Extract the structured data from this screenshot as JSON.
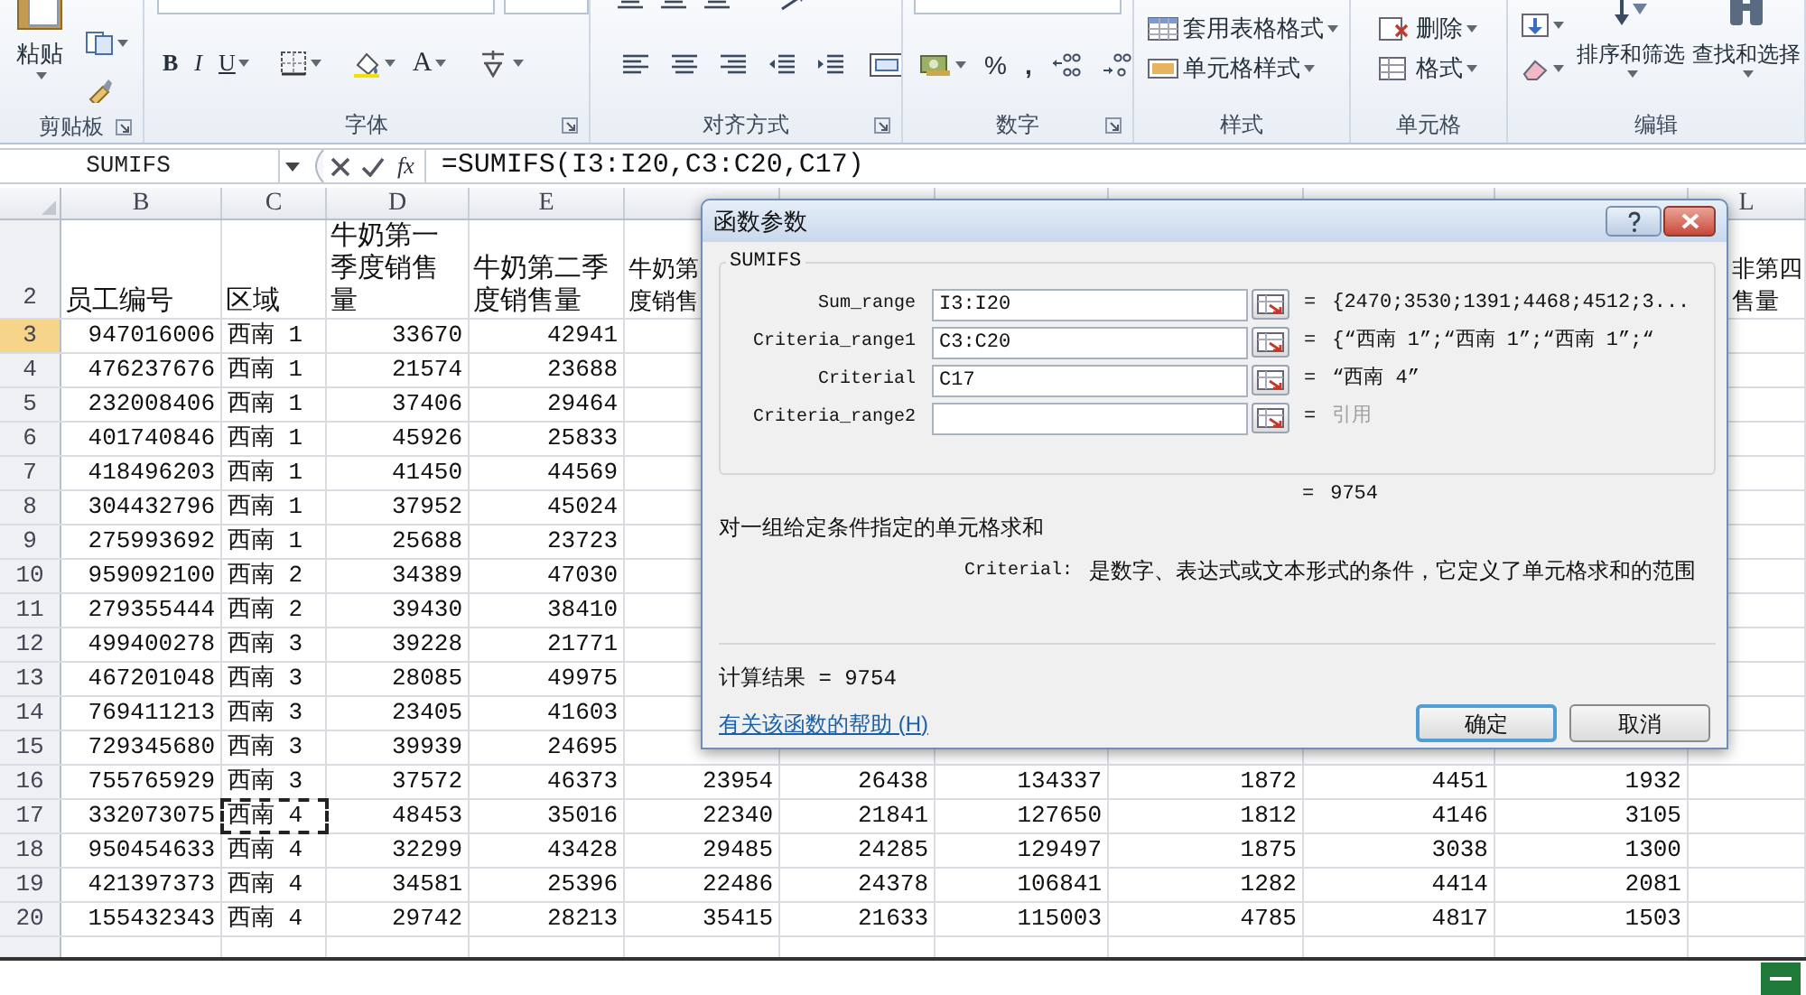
{
  "ribbon": {
    "paste": "粘贴",
    "bold": "B",
    "italic": "I",
    "underline": "U",
    "font_color": "A",
    "percent": "%",
    "comma": ",",
    "table_format": "套用表格格式",
    "cell_styles": "单元格样式",
    "delete": "删除",
    "format": "格式",
    "sort_filter": "排序和筛选",
    "find_select": "查找和选择",
    "groups": [
      {
        "label": "剪贴板",
        "launcher": true
      },
      {
        "label": "字体",
        "launcher": true
      },
      {
        "label": "对齐方式",
        "launcher": true
      },
      {
        "label": "数字",
        "launcher": true
      },
      {
        "label": "样式",
        "launcher": false
      },
      {
        "label": "单元格",
        "launcher": false
      },
      {
        "label": "编辑",
        "launcher": false
      }
    ]
  },
  "formula_bar": {
    "name_box": "SUMIFS",
    "insert_function": "fx",
    "formula": "=SUMIFS(I3:I20,C3:C20,C17)"
  },
  "columns": [
    {
      "letter": "B"
    },
    {
      "letter": "C"
    },
    {
      "letter": "D"
    },
    {
      "letter": "E"
    },
    {},
    {},
    {},
    {},
    {},
    {},
    {
      "letter": "L"
    }
  ],
  "header_row": {
    "number": "2",
    "cells": [
      [
        "员工编号"
      ],
      [
        "区域"
      ],
      [
        "牛奶第一",
        "季度销售",
        "量"
      ],
      [
        "牛奶第二季",
        "度销售量"
      ],
      [
        "牛奶第",
        "度销售"
      ],
      null,
      null,
      null,
      null,
      null,
      [
        "非第四",
        "售量"
      ]
    ]
  },
  "rows": [
    {
      "number": "3",
      "highlighted": true,
      "marquee": false,
      "cells": [
        "947016006",
        "西南 1",
        "33670",
        "42941"
      ]
    },
    {
      "number": "4",
      "highlighted": false,
      "marquee": false,
      "cells": [
        "476237676",
        "西南 1",
        "21574",
        "23688"
      ]
    },
    {
      "number": "5",
      "highlighted": false,
      "marquee": false,
      "cells": [
        "232008406",
        "西南 1",
        "37406",
        "29464"
      ]
    },
    {
      "number": "6",
      "highlighted": false,
      "marquee": false,
      "cells": [
        "401740846",
        "西南 1",
        "45926",
        "25833"
      ]
    },
    {
      "number": "7",
      "highlighted": false,
      "marquee": false,
      "cells": [
        "418496203",
        "西南 1",
        "41450",
        "44569"
      ]
    },
    {
      "number": "8",
      "highlighted": false,
      "marquee": false,
      "cells": [
        "304432796",
        "西南 1",
        "37952",
        "45024"
      ]
    },
    {
      "number": "9",
      "highlighted": false,
      "marquee": false,
      "cells": [
        "275993692",
        "西南 1",
        "25688",
        "23723"
      ]
    },
    {
      "number": "10",
      "highlighted": false,
      "marquee": false,
      "cells": [
        "959092100",
        "西南 2",
        "34389",
        "47030"
      ]
    },
    {
      "number": "11",
      "highlighted": false,
      "marquee": false,
      "cells": [
        "279355444",
        "西南 2",
        "39430",
        "38410"
      ]
    },
    {
      "number": "12",
      "highlighted": false,
      "marquee": false,
      "cells": [
        "499400278",
        "西南 3",
        "39228",
        "21771"
      ]
    },
    {
      "number": "13",
      "highlighted": false,
      "marquee": false,
      "cells": [
        "467201048",
        "西南 3",
        "28085",
        "49975"
      ]
    },
    {
      "number": "14",
      "highlighted": false,
      "marquee": false,
      "cells": [
        "769411213",
        "西南 3",
        "23405",
        "41603"
      ]
    },
    {
      "number": "15",
      "highlighted": false,
      "marquee": false,
      "cells": [
        "729345680",
        "西南 3",
        "39939",
        "24695"
      ]
    },
    {
      "number": "16",
      "highlighted": false,
      "marquee": false,
      "cells": [
        "755765929",
        "西南 3",
        "37572",
        "46373",
        "23954",
        "26438",
        "134337",
        "1872",
        "4451",
        "1932"
      ]
    },
    {
      "number": "17",
      "highlighted": false,
      "marquee": true,
      "cells": [
        "332073075",
        "西南 4",
        "48453",
        "35016",
        "22340",
        "21841",
        "127650",
        "1812",
        "4146",
        "3105"
      ]
    },
    {
      "number": "18",
      "highlighted": false,
      "marquee": false,
      "cells": [
        "950454633",
        "西南 4",
        "32299",
        "43428",
        "29485",
        "24285",
        "129497",
        "1875",
        "3038",
        "1300"
      ]
    },
    {
      "number": "19",
      "highlighted": false,
      "marquee": false,
      "cells": [
        "421397373",
        "西南 4",
        "34581",
        "25396",
        "22486",
        "24378",
        "106841",
        "1282",
        "4414",
        "2081"
      ]
    },
    {
      "number": "20",
      "highlighted": false,
      "marquee": false,
      "cells": [
        "155432343",
        "西南 4",
        "29742",
        "28213",
        "35415",
        "21633",
        "115003",
        "4785",
        "4817",
        "1503"
      ]
    }
  ],
  "dialog": {
    "title": "函数参数",
    "function": "SUMIFS",
    "arguments": [
      {
        "label": "Sum_range",
        "value": "I3:I20",
        "equals": "=",
        "result": "{2470;3530;1391;4468;4512;3...",
        "muted": false
      },
      {
        "label": "Criteria_range1",
        "value": "C3:C20",
        "equals": "=",
        "result": "{“西南 1”;“西南 1”;“西南 1”;“",
        "muted": false
      },
      {
        "label": "Criterial",
        "value": "C17",
        "equals": "=",
        "result": "“西南 4”",
        "muted": false
      },
      {
        "label": "Criteria_range2",
        "equals": "=",
        "result": "引用",
        "muted": true
      }
    ],
    "formula_result": {
      "equals": "=",
      "value": "9754"
    },
    "description": "对一组给定条件指定的单元格求和",
    "argument_help": {
      "name": "Criterial:",
      "text": "是数字、表达式或文本形式的条件，它定义了单元格求和的范围"
    },
    "calculation_result": "计算结果 = 9754",
    "help_link": "有关该函数的帮助 (H)",
    "buttons": [
      {
        "label": "确定",
        "default": true
      },
      {
        "label": "取消",
        "default": false
      }
    ]
  }
}
